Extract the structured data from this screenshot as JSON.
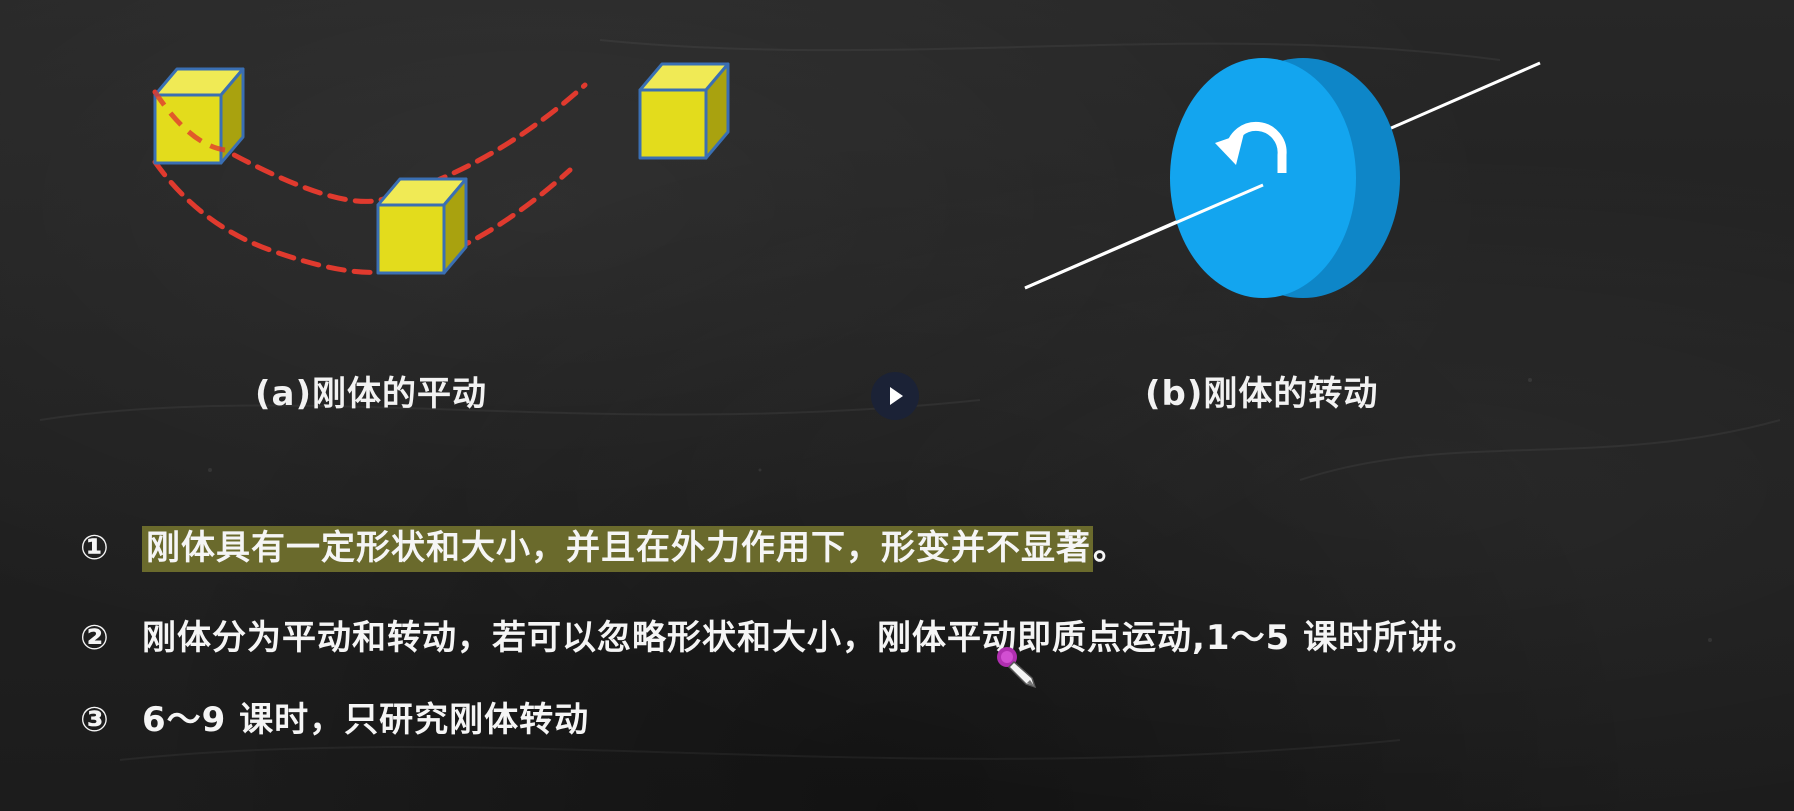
{
  "captions": {
    "a": "(a)刚体的平动",
    "b": "(b)刚体的转动"
  },
  "points": [
    {
      "num": "①",
      "highlighted": "刚体具有一定形状和大小，并且在外力作用下，形变并不显著",
      "tail": "。"
    },
    {
      "num": "②",
      "text": "刚体分为平动和转动，若可以忽略形状和大小，刚体平动即质点运动,1～5 课时所讲。"
    },
    {
      "num": "③",
      "text": "6～9 课时，只研究刚体转动"
    }
  ],
  "icons": {
    "play": "play-icon",
    "rotation": "rotate-arrow-icon",
    "cursor": "pen-cursor-icon"
  },
  "colors": {
    "cube": "#e3dc1c",
    "cube_edge": "#3a6fb3",
    "path": "#e03a2e",
    "disk": "#13a5ef",
    "highlight": "#6a6a2c"
  }
}
